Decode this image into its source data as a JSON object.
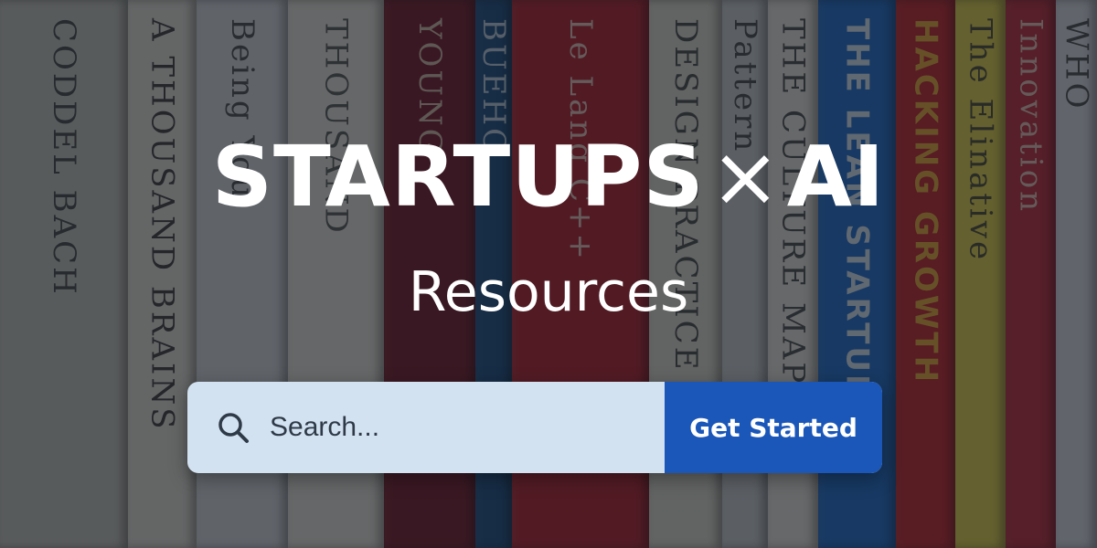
{
  "hero": {
    "title_left": "STARTUPS",
    "title_sep": "×",
    "title_right": "AI",
    "subtitle": "Resources"
  },
  "search": {
    "placeholder": "Search...",
    "icon": "search-icon"
  },
  "cta": {
    "label": "Get Started"
  },
  "colors": {
    "overlay": "#14181e",
    "search_bg": "#d3e2f1",
    "cta_bg": "#1b57b8",
    "text": "#ffffff"
  }
}
